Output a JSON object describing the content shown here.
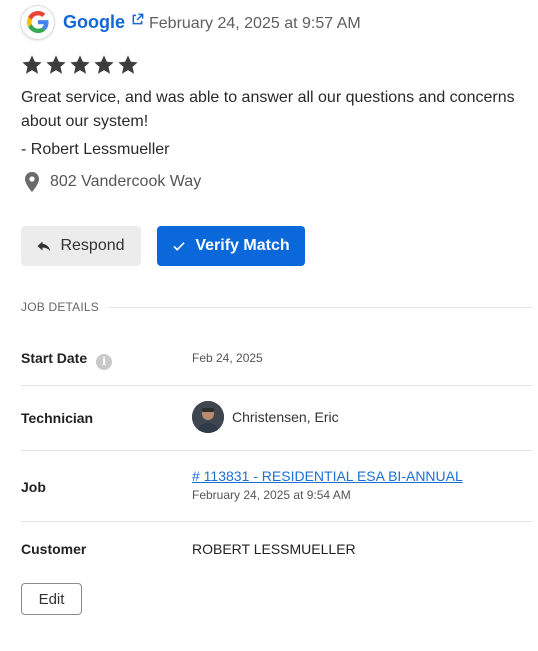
{
  "review": {
    "source_name": "Google",
    "date": "February 24, 2025 at 9:57 AM",
    "rating": 5,
    "text": "Great service, and was able to answer all our questions and concerns about our system!",
    "author": "- Robert Lessmueller",
    "location": "802 Vandercook Way"
  },
  "actions": {
    "respond_label": "Respond",
    "verify_label": "Verify Match"
  },
  "job_details": {
    "section_title": "JOB DETAILS",
    "start_date_label": "Start Date",
    "start_date_value": "Feb 24, 2025",
    "technician_label": "Technician",
    "technician_name": "Christensen, Eric",
    "job_label": "Job",
    "job_link_text": "# 113831 - RESIDENTIAL ESA BI-ANNUAL",
    "job_date": "February 24, 2025 at 9:54 AM",
    "customer_label": "Customer",
    "customer_value": "ROBERT LESSMUELLER",
    "edit_label": "Edit"
  },
  "colors": {
    "accent_blue": "#0b68da",
    "link_blue": "#1c6fd6",
    "star_color": "#3d3d3d"
  },
  "icons": [
    "google-logo-icon",
    "external-link-icon",
    "star-icon",
    "map-pin-icon",
    "reply-arrow-icon",
    "checkmark-icon",
    "info-icon"
  ]
}
